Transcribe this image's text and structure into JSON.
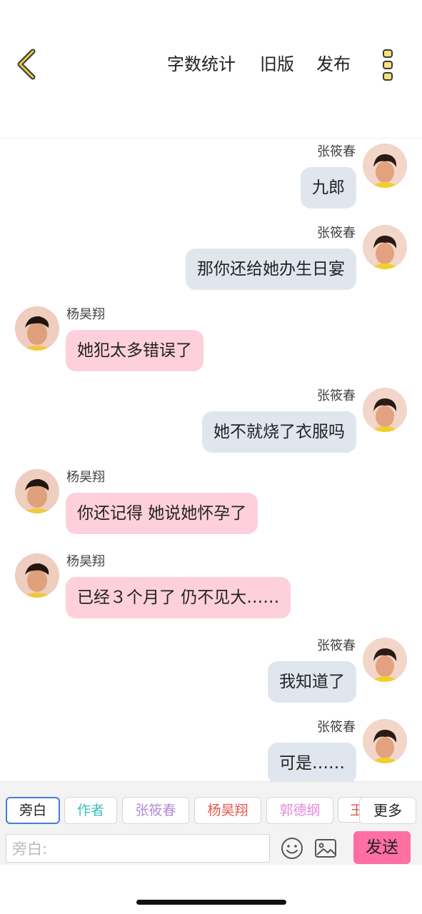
{
  "header": {
    "back_icon": "chevron-left-icon",
    "word_count_label": "字数统计",
    "old_version_label": "旧版",
    "publish_label": "发布",
    "menu_icon": "vertical-dots-icon"
  },
  "messages": [
    {
      "side": "right",
      "name": "张筱春",
      "text": "九郎"
    },
    {
      "side": "right",
      "name": "张筱春",
      "text": "那你还给她办生日宴"
    },
    {
      "side": "left",
      "name": "杨昊翔",
      "text": "她犯太多错误了"
    },
    {
      "side": "right",
      "name": "张筱春",
      "text": "她不就烧了衣服吗"
    },
    {
      "side": "left",
      "name": "杨昊翔",
      "text": "你还记得 她说她怀孕了"
    },
    {
      "side": "left",
      "name": "杨昊翔",
      "text": "已经３个月了 仍不见大……"
    },
    {
      "side": "right",
      "name": "张筱春",
      "text": "我知道了"
    },
    {
      "side": "right",
      "name": "张筱春",
      "text": "可是……"
    }
  ],
  "roles": [
    {
      "label": "旁白",
      "color": "#222222",
      "active": true
    },
    {
      "label": "作者",
      "color": "#3bbfc0",
      "active": false
    },
    {
      "label": "张筱春",
      "color": "#b38bd6",
      "active": false
    },
    {
      "label": "杨昊翔",
      "color": "#e0584d",
      "active": false
    },
    {
      "label": "郭德纲",
      "color": "#e08ad8",
      "active": false
    },
    {
      "label": "王",
      "color": "#e05050",
      "active": false
    }
  ],
  "more_label": "更多",
  "input": {
    "placeholder": "旁白:"
  },
  "send_label": "发送",
  "colors": {
    "accent_pink": "#ff6fa2",
    "bubble_left": "#fdd0dc",
    "bubble_right": "#dfe6ee",
    "icon_gold": "#c9a227"
  }
}
